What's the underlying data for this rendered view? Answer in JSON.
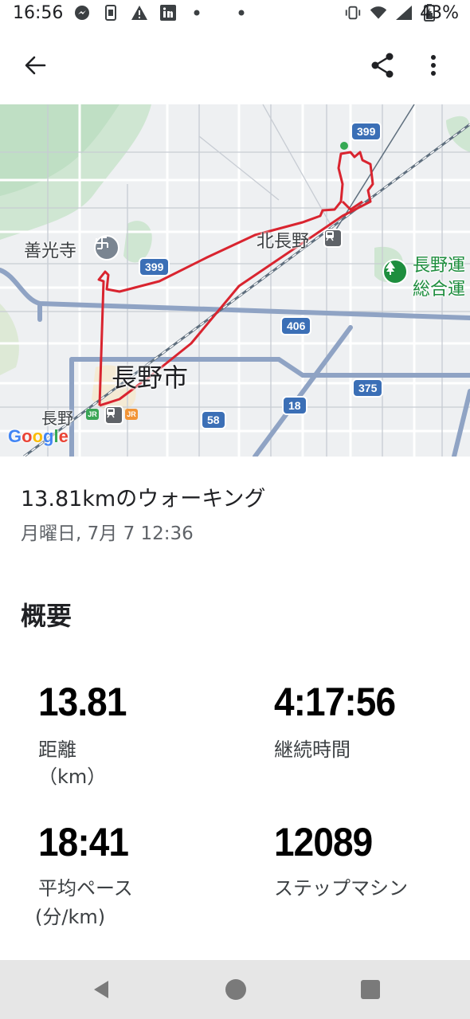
{
  "status_bar": {
    "time": "16:56",
    "battery": "43%",
    "icons_left": [
      "messenger-icon",
      "sim-icon",
      "warning-icon",
      "linkedin-icon",
      "dot-icon",
      "dot-icon"
    ],
    "icons_right": [
      "vibrate-icon",
      "wifi-icon",
      "signal-icon",
      "battery-icon"
    ]
  },
  "map": {
    "labels": {
      "zenkoji": "善光寺",
      "kita_nagano": "北長野",
      "nagano_city": "長野市",
      "nagano_station": "長野",
      "park_line1": "長野運",
      "park_line2": "総合運",
      "google": "Google"
    },
    "roads": {
      "r399a": "399",
      "r399b": "399",
      "r406": "406",
      "r375": "375",
      "r18": "18",
      "r58": "58"
    },
    "route_color": "#d9242f"
  },
  "activity": {
    "title": "13.81kmのウォーキング",
    "date": "月曜日, 7月 7 12:36"
  },
  "overview": {
    "section_title": "概要",
    "distance_value": "13.81",
    "distance_label": "距離",
    "distance_unit": "（km）",
    "duration_value": "4:17:56",
    "duration_label": "継続時間",
    "pace_value": "18:41",
    "pace_label": "平均ペース",
    "pace_unit": "(分/km)",
    "steps_value": "12089",
    "steps_label": "ステップマシン"
  }
}
